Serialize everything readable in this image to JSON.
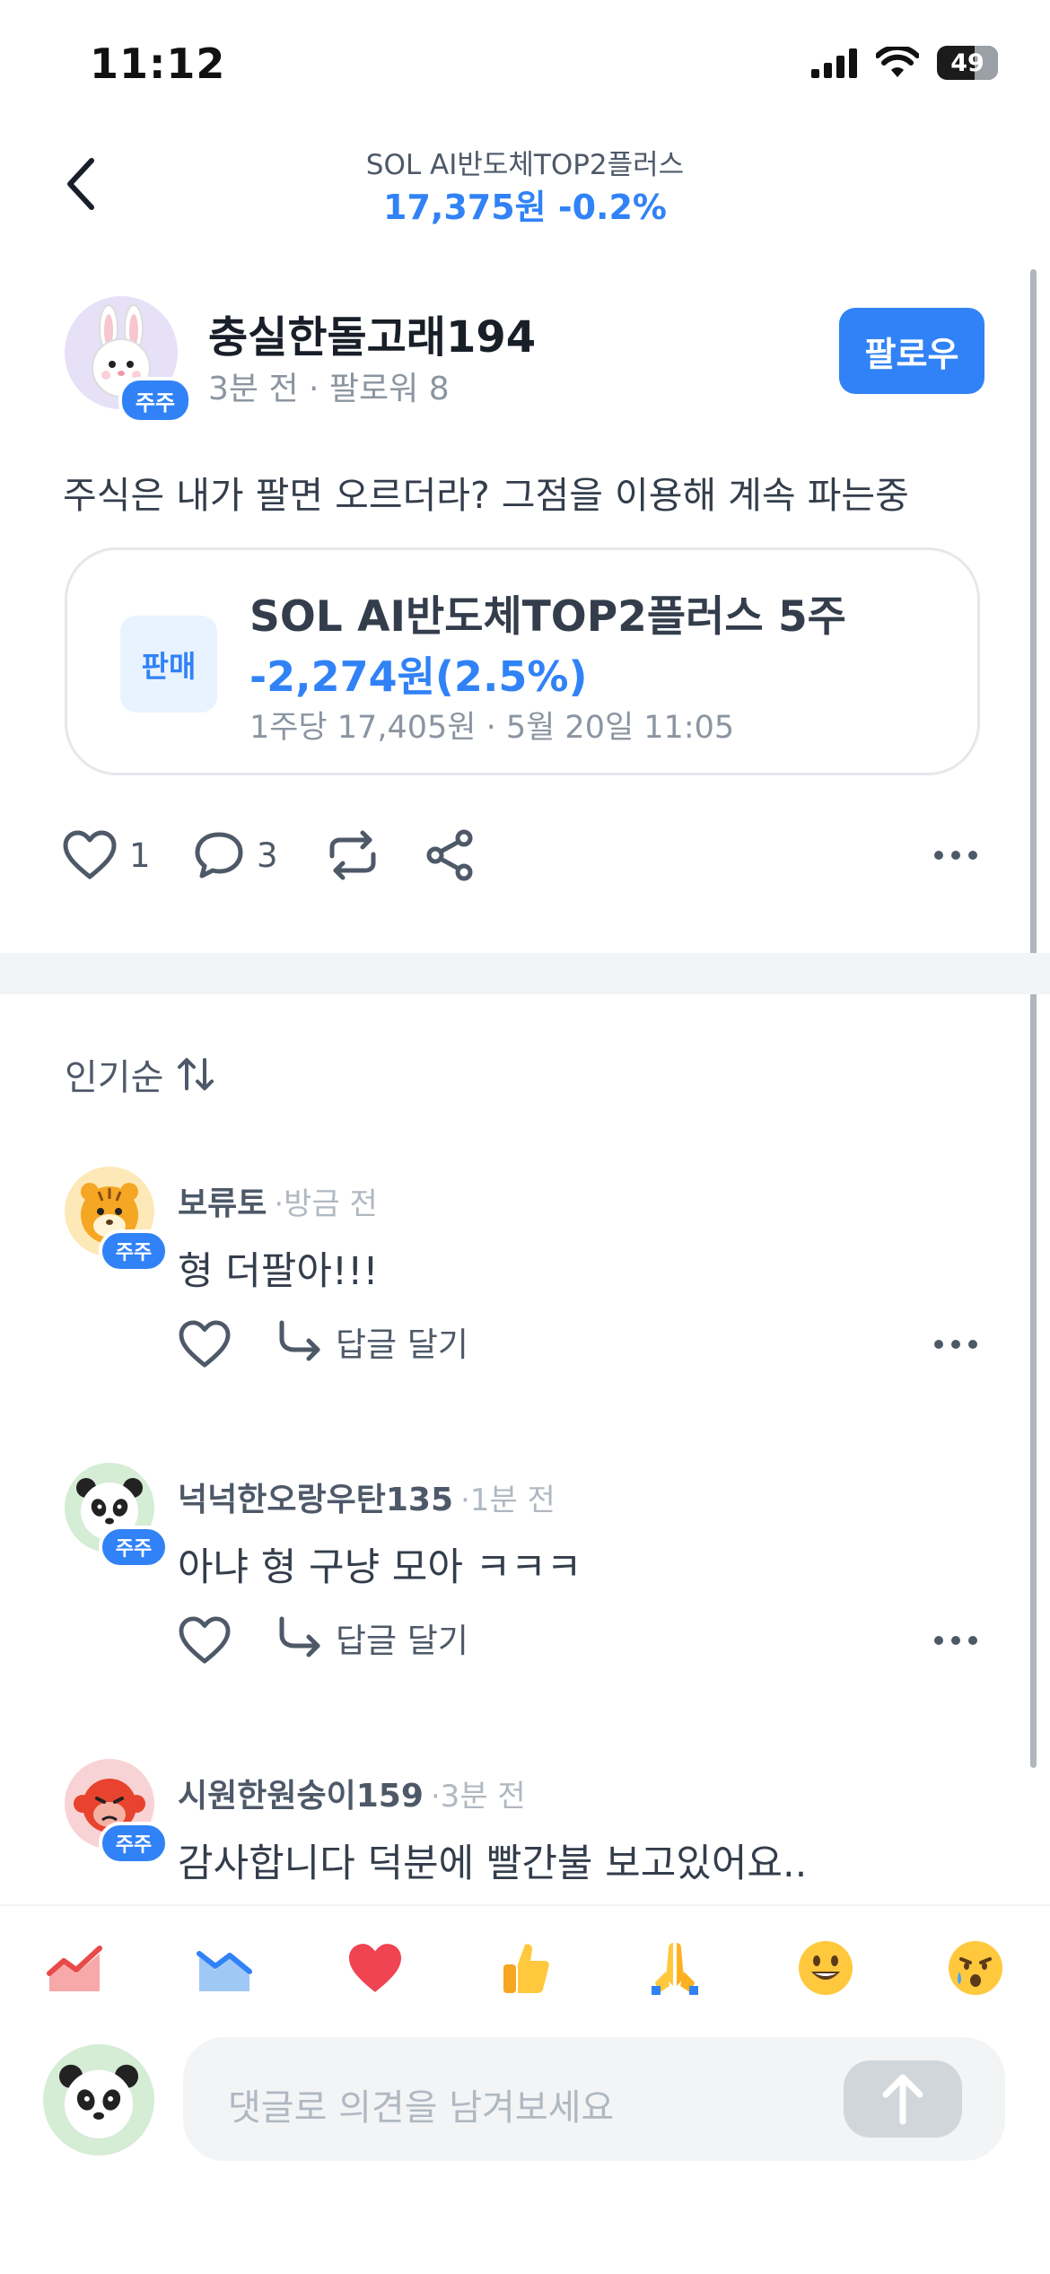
{
  "status_bar": {
    "time": "11:12",
    "battery": "49"
  },
  "header": {
    "stock_name": "SOL AI반도체TOP2플러스",
    "price_line": "17,375원 -0.2%"
  },
  "post": {
    "author": "충실한돌고래194",
    "badge": "주주",
    "meta": "3분 전 · 팔로워 8",
    "follow_label": "팔로우",
    "text": "주식은 내가 팔면 오르더라? 그점을 이용해 계속 파는중",
    "trade": {
      "type_label": "판매",
      "title": "SOL AI반도체TOP2플러스 5주",
      "change": "-2,274원(2.5%)",
      "info": "1주당 17,405원 · 5월 20일 11:05"
    },
    "likes": "1",
    "comments": "3"
  },
  "sort": {
    "label": "인기순"
  },
  "comments": [
    {
      "name": "보류토",
      "time": "·방금 전",
      "text": "형 더팔아!!!",
      "badge": "주주",
      "reply_label": "답글 달기"
    },
    {
      "name": "넉넉한오랑우탄135",
      "time": "·1분 전",
      "text": "아냐 형 구냥 모아 ㅋㅋㅋ",
      "badge": "주주",
      "reply_label": "답글 달기"
    },
    {
      "name": "시원한원숭이159",
      "time": "·3분 전",
      "text": "감사합니다 덕분에 빨간불 보고있어요..",
      "badge": "주주"
    }
  ],
  "reactions": [
    "rising-chart-icon",
    "falling-chart-icon",
    "heart-icon",
    "thumbs-up-icon",
    "praying-hands-icon",
    "smile-face-icon",
    "crying-face-icon"
  ],
  "composer": {
    "placeholder": "댓글로 의견을 남겨보세요"
  },
  "colors": {
    "accent": "#3182f6",
    "text": "#333d4b",
    "sub": "#8b95a1"
  }
}
